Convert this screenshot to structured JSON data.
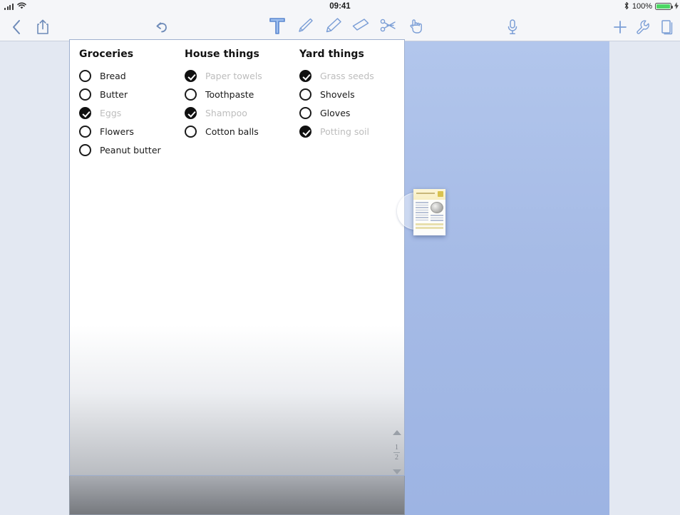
{
  "status_bar": {
    "signal_icon": "cellular-signal-icon",
    "wifi_icon": "wifi-icon",
    "time": "09:41",
    "bluetooth_icon": "bluetooth-icon",
    "battery_percent": "100%",
    "battery_icon": "battery-full-icon",
    "charging_icon": "charging-bolt-icon"
  },
  "toolbar": {
    "back_icon": "back-chevron-icon",
    "share_icon": "share-icon",
    "undo_icon": "undo-arrow-icon",
    "tools": [
      {
        "name": "text-tool",
        "icon": "text-t-icon",
        "active": true
      },
      {
        "name": "pen-tool",
        "icon": "pen-icon",
        "active": false
      },
      {
        "name": "highlighter-tool",
        "icon": "highlighter-icon",
        "active": false
      },
      {
        "name": "eraser-tool",
        "icon": "eraser-icon",
        "active": false
      },
      {
        "name": "scissors-tool",
        "icon": "scissors-icon",
        "active": false
      },
      {
        "name": "hand-tool",
        "icon": "hand-pointer-icon",
        "active": false
      }
    ],
    "mic_icon": "microphone-icon",
    "add_icon": "plus-icon",
    "settings_icon": "wrench-icon",
    "pages_icon": "pages-icon"
  },
  "document": {
    "columns": [
      {
        "title": "Groceries",
        "items": [
          {
            "label": "Bread",
            "checked": false
          },
          {
            "label": "Butter",
            "checked": false
          },
          {
            "label": "Eggs",
            "checked": true
          },
          {
            "label": "Flowers",
            "checked": false
          },
          {
            "label": "Peanut butter",
            "checked": false
          }
        ]
      },
      {
        "title": "House things",
        "items": [
          {
            "label": "Paper towels",
            "checked": true
          },
          {
            "label": "Toothpaste",
            "checked": false
          },
          {
            "label": "Shampoo",
            "checked": true
          },
          {
            "label": "Cotton balls",
            "checked": false
          }
        ]
      },
      {
        "title": "Yard things",
        "items": [
          {
            "label": "Grass seeds",
            "checked": true
          },
          {
            "label": "Shovels",
            "checked": false
          },
          {
            "label": "Gloves",
            "checked": false
          },
          {
            "label": "Potting soil",
            "checked": true
          }
        ]
      }
    ]
  },
  "drag_item": {
    "name": "dragged-page-thumbnail",
    "touch_indicator": "finger-touch-indicator"
  },
  "page_nav": {
    "up_icon": "scroll-up-arrow-icon",
    "current_page": "1",
    "total_pages": "2",
    "down_icon": "scroll-down-arrow-icon"
  },
  "colors": {
    "canvas_blue": "#a6bbe6",
    "chrome_grey": "#f5f6f9",
    "accent_blue": "#7a9ad6",
    "battery_green": "#4cd764",
    "checked_text": "#bdbdbd"
  }
}
